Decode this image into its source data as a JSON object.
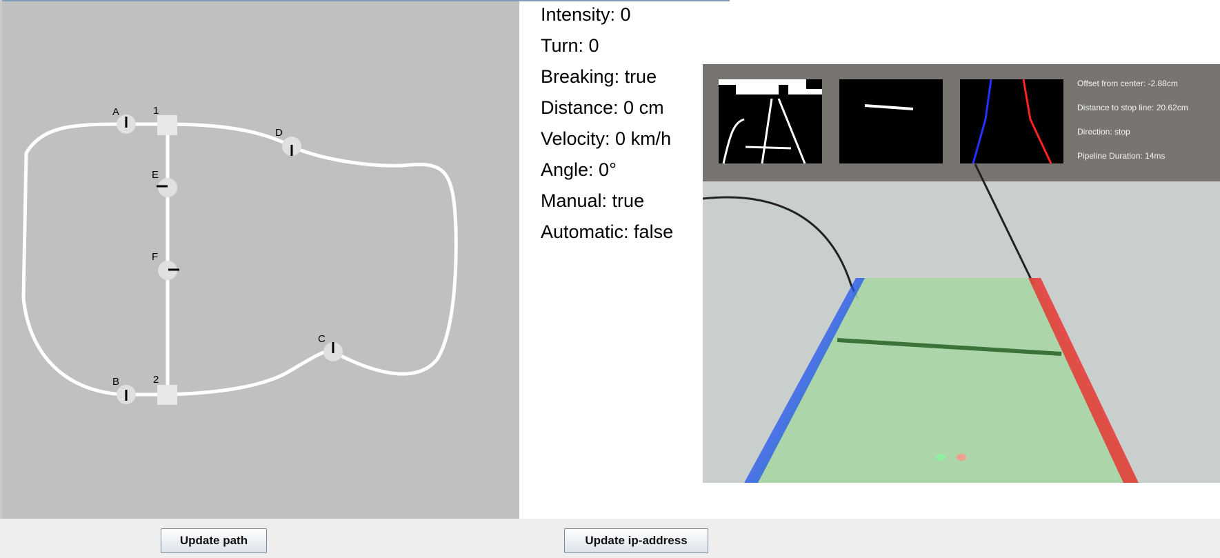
{
  "map": {
    "nodes": {
      "A": "A",
      "B": "B",
      "C": "C",
      "D": "D",
      "E": "E",
      "F": "F",
      "one": "1",
      "two": "2"
    }
  },
  "status": {
    "intensity": "Intensity: 0",
    "turn": "Turn: 0",
    "breaking": "Breaking: true",
    "distance": "Distance: 0 cm",
    "velocity": "Velocity: 0 km/h",
    "angle": "Angle: 0°",
    "manual": "Manual: true",
    "automatic": "Automatic: false"
  },
  "camera": {
    "offset": "Offset from center: -2.88cm",
    "stop_line": "Distance to stop line: 20.62cm",
    "direction": "Direction: stop",
    "pipeline": "Pipeline Duration: 14ms"
  },
  "buttons": {
    "update_path": "Update path",
    "update_ip": "Update ip-address"
  },
  "colors": {
    "map_background": "#c0c0c0",
    "track": "#ffffff",
    "lane_fill": "#a9d6a6",
    "left_lane": "#2255ee",
    "right_lane": "#ee2222"
  }
}
